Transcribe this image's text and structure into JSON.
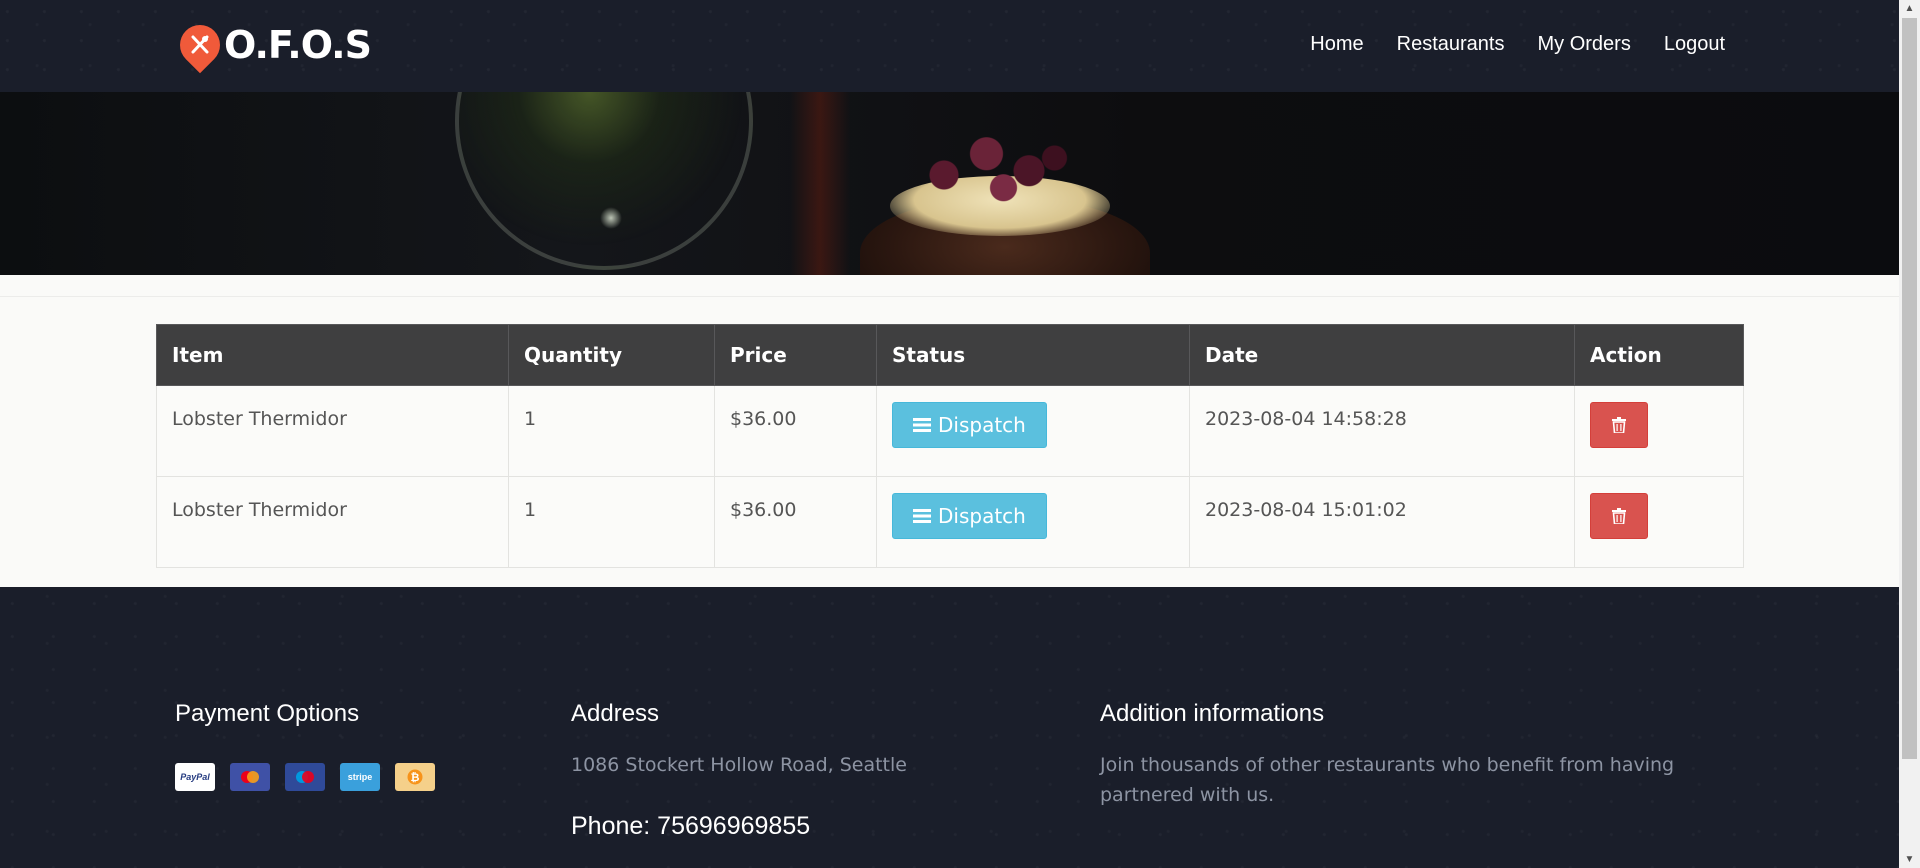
{
  "brand": {
    "name": "O.F.O.S",
    "accent": "#f05a3a"
  },
  "nav": {
    "items": [
      {
        "label": "Home"
      },
      {
        "label": "Restaurants"
      },
      {
        "label": "My Orders"
      },
      {
        "label": "Logout"
      }
    ]
  },
  "orders": {
    "columns": [
      "Item",
      "Quantity",
      "Price",
      "Status",
      "Date",
      "Action"
    ],
    "rows": [
      {
        "item": "Lobster Thermidor",
        "quantity": "1",
        "price": "$36.00",
        "status": "Dispatch",
        "date": "2023-08-04 14:58:28",
        "action_icon": "trash-icon"
      },
      {
        "item": "Lobster Thermidor",
        "quantity": "1",
        "price": "$36.00",
        "status": "Dispatch",
        "date": "2023-08-04 15:01:02",
        "action_icon": "trash-icon"
      }
    ],
    "colors": {
      "header_bg": "#3f3f40",
      "status_button": "#5bc0de",
      "delete_button": "#d9534f"
    }
  },
  "footer": {
    "payment": {
      "title": "Payment Options",
      "cards": [
        {
          "label": "PayPal",
          "icon": "paypal-icon"
        },
        {
          "label": "",
          "icon": "mastercard-icon"
        },
        {
          "label": "",
          "icon": "maestro-icon"
        },
        {
          "label": "stripe",
          "icon": "stripe-icon"
        },
        {
          "label": "",
          "icon": "bitcoin-icon"
        }
      ]
    },
    "address": {
      "title": "Address",
      "text": "1086 Stockert Hollow Road, Seattle",
      "phone": "Phone: 75696969855"
    },
    "info": {
      "title": "Addition informations",
      "text": "Join thousands of other restaurants who benefit from having partnered with us."
    }
  }
}
